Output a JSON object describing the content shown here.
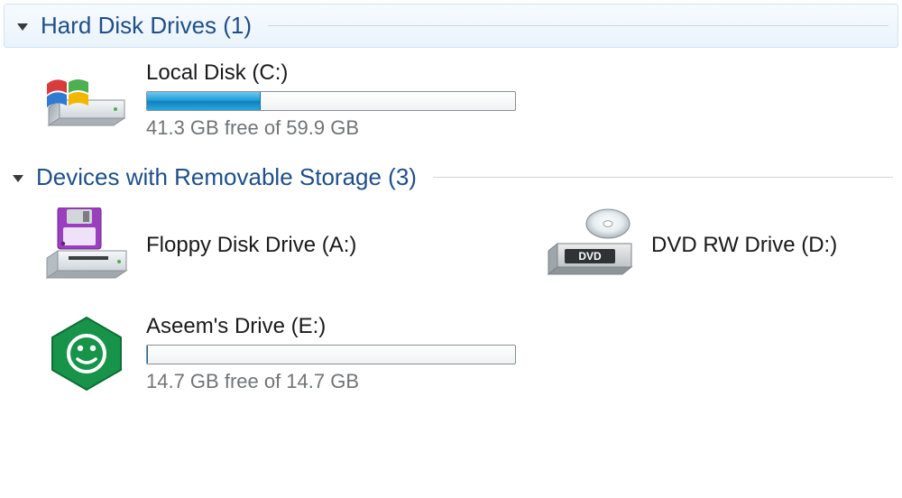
{
  "groups": [
    {
      "id": "hdd",
      "label": "Hard Disk Drives (1)",
      "drives": [
        {
          "id": "c",
          "name": "Local Disk (C:)",
          "icon": "hdd-windows",
          "has_bar": true,
          "used_pct": 31,
          "free_text": "41.3 GB free of 59.9 GB"
        }
      ]
    },
    {
      "id": "removable",
      "label": "Devices with Removable Storage (3)",
      "drives": [
        {
          "id": "a",
          "name": "Floppy Disk Drive (A:)",
          "icon": "floppy",
          "has_bar": false
        },
        {
          "id": "d",
          "name": "DVD RW Drive (D:)",
          "icon": "dvd",
          "has_bar": false
        },
        {
          "id": "e",
          "name": "Aseem's Drive (E:)",
          "icon": "hex-smiley",
          "has_bar": true,
          "used_pct": 0,
          "free_text": "14.7 GB free of 14.7 GB"
        }
      ]
    }
  ]
}
